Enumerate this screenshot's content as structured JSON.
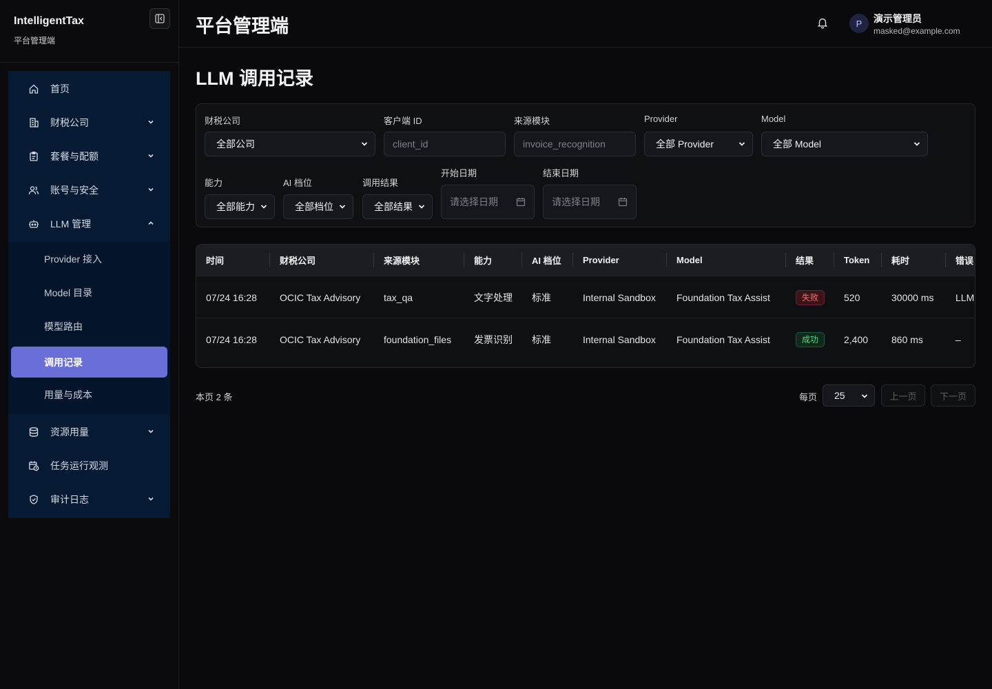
{
  "brand": {
    "name": "IntelligentTax",
    "subtitle": "平台管理端"
  },
  "topbar": {
    "title": "平台管理端",
    "user_initial": "P",
    "user_name": "演示管理员",
    "user_email": "masked@example.com"
  },
  "sidebar": {
    "items": [
      {
        "label": "首页",
        "icon": "home-icon"
      },
      {
        "label": "财税公司",
        "icon": "building-icon",
        "expandable": true
      },
      {
        "label": "套餐与配额",
        "icon": "clipboard-icon",
        "expandable": true
      },
      {
        "label": "账号与安全",
        "icon": "users-icon",
        "expandable": true
      },
      {
        "label": "LLM 管理",
        "icon": "robot-icon",
        "expanded": true
      },
      {
        "label": "资源用量",
        "icon": "database-icon",
        "expandable": true
      },
      {
        "label": "任务运行观测",
        "icon": "calendar-clock-icon"
      },
      {
        "label": "审计日志",
        "icon": "shield-check-icon",
        "expandable": true
      }
    ],
    "llm_subitems": [
      {
        "label": "Provider 接入"
      },
      {
        "label": "Model 目录"
      },
      {
        "label": "模型路由"
      },
      {
        "label": "调用记录",
        "active": true
      },
      {
        "label": "用量与成本"
      }
    ]
  },
  "page": {
    "title": "LLM 调用记录"
  },
  "filters": {
    "company": {
      "label": "财税公司",
      "value": "全部公司"
    },
    "client_id": {
      "label": "客户端 ID",
      "placeholder": "client_id"
    },
    "source_module": {
      "label": "来源模块",
      "placeholder": "invoice_recognition"
    },
    "provider": {
      "label": "Provider",
      "value": "全部 Provider"
    },
    "model": {
      "label": "Model",
      "value": "全部 Model"
    },
    "capability": {
      "label": "能力",
      "value": "全部能力"
    },
    "ai_tier": {
      "label": "AI 档位",
      "value": "全部档位"
    },
    "result": {
      "label": "调用结果",
      "value": "全部结果"
    },
    "start_date": {
      "label": "开始日期",
      "placeholder": "请选择日期"
    },
    "end_date": {
      "label": "结束日期",
      "placeholder": "请选择日期"
    }
  },
  "table": {
    "headers": [
      "时间",
      "财税公司",
      "来源模块",
      "能力",
      "AI 档位",
      "Provider",
      "Model",
      "结果",
      "Token",
      "耗时",
      "错误"
    ],
    "rows": [
      {
        "time": "07/24 16:28",
        "company": "OCIC Tax Advisory",
        "module": "tax_qa",
        "capability": "文字处理",
        "tier": "标准",
        "provider": "Internal Sandbox",
        "model": "Foundation Tax Assist",
        "result": "失败",
        "result_status": "fail",
        "token": "520",
        "latency": "30000 ms",
        "error": "LLM"
      },
      {
        "time": "07/24 16:28",
        "company": "OCIC Tax Advisory",
        "module": "foundation_files",
        "capability": "发票识别",
        "tier": "标准",
        "provider": "Internal Sandbox",
        "model": "Foundation Tax Assist",
        "result": "成功",
        "result_status": "ok",
        "token": "2,400",
        "latency": "860 ms",
        "error": "–"
      }
    ]
  },
  "pagination": {
    "count_text": "本页 2 条",
    "per_page_label": "每页",
    "per_page_value": "25",
    "prev_label": "上一页",
    "next_label": "下一页"
  },
  "colors": {
    "accent": "#6a6fd8",
    "nav_bg": "#071a33",
    "fail": "#ff6b6b",
    "ok": "#4ade80"
  }
}
